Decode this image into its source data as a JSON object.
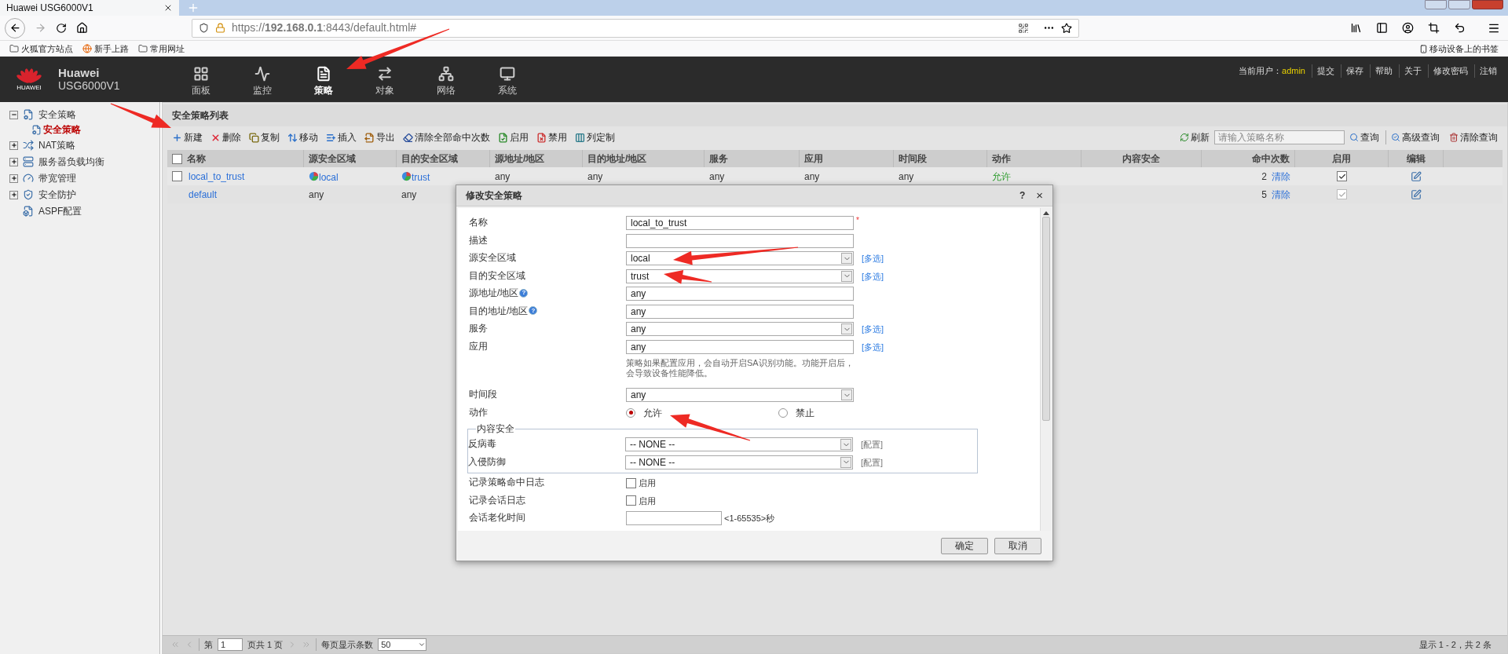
{
  "browser": {
    "tab_title": "Huawei USG6000V1",
    "url": "https://**192.168.0.1**:8443/default.html#",
    "bookmarks": [
      "火狐官方站点",
      "新手上路",
      "常用网址"
    ],
    "mobile_bookmarks": "移动设备上的书签"
  },
  "header": {
    "logo_text": "HUAWEI",
    "brand": "Huawei",
    "model": "USG6000V1",
    "nav": [
      {
        "label": "面板",
        "selected": false
      },
      {
        "label": "监控",
        "selected": false
      },
      {
        "label": "策略",
        "selected": true
      },
      {
        "label": "对象",
        "selected": false
      },
      {
        "label": "网络",
        "selected": false
      },
      {
        "label": "系统",
        "selected": false
      }
    ],
    "user_label": "当前用户：",
    "user": "admin",
    "links": [
      "提交",
      "保存",
      "帮助",
      "关于",
      "修改密码",
      "注销"
    ]
  },
  "sidebar": {
    "items": [
      {
        "label": "安全策略",
        "expanded": true,
        "selected": false,
        "children": [
          {
            "label": "安全策略",
            "selected": true
          }
        ]
      },
      {
        "label": "NAT策略",
        "expanded": false,
        "selected": false
      },
      {
        "label": "服务器负载均衡",
        "expanded": false,
        "selected": false
      },
      {
        "label": "带宽管理",
        "expanded": false,
        "selected": false
      },
      {
        "label": "安全防护",
        "expanded": false,
        "selected": false
      },
      {
        "label": "ASPF配置",
        "selected": false
      }
    ]
  },
  "panel": {
    "title": "安全策略列表",
    "toolbar": [
      "新建",
      "删除",
      "复制",
      "移动",
      "插入",
      "导出",
      "清除全部命中次数",
      "启用",
      "禁用",
      "列定制"
    ],
    "refresh": "刷新",
    "search": {
      "placeholder": "请输入策略名称"
    },
    "query": "查询",
    "advanced_query": "高级查询",
    "clear_query": "清除查询",
    "table": {
      "select_all_checked": false,
      "columns": [
        "名称",
        "源安全区域",
        "目的安全区域",
        "源地址/地区",
        "目的地址/地区",
        "服务",
        "应用",
        "时间段",
        "动作",
        "内容安全",
        "命中次数",
        "启用",
        "编辑"
      ],
      "rows": [
        {
          "checked": false,
          "name": "local_to_trust",
          "src_zone": "local",
          "dst_zone": "trust",
          "src_zone_icon": true,
          "src_addr": "any",
          "dst_addr": "any",
          "service": "any",
          "application": "any",
          "schedule": "any",
          "action": "允许",
          "hits": "2",
          "clear": "清除",
          "enabled": true,
          "enabled_disabled": false
        },
        {
          "name": "default",
          "src_zone": "any",
          "dst_zone": "any",
          "src_zone_icon": false,
          "hits": "5",
          "clear": "清除",
          "enabled": true,
          "enabled_disabled": true
        }
      ]
    }
  },
  "pagination": {
    "page_prefix": "第",
    "page": "1",
    "page_suffix": "页共 1 页",
    "per_page_label": "每页显示条数",
    "per_page": "50",
    "summary": "显示 1 - 2，共 2 条"
  },
  "dialog": {
    "title": "修改安全策略",
    "help": "?",
    "close": "×",
    "fields": [
      {
        "kind": "text",
        "label": "名称",
        "value": "local_to_trust",
        "required": "*"
      },
      {
        "kind": "text",
        "label": "描述"
      },
      {
        "kind": "select",
        "label": "源安全区域",
        "value": "local",
        "link": {
          "label": "[多选]",
          "disabled": false
        }
      },
      {
        "kind": "select",
        "label": "目的安全区域",
        "value": "trust",
        "link": {
          "label": "[多选]",
          "disabled": false
        }
      },
      {
        "kind": "text",
        "label": "源地址/地区",
        "value": "any",
        "help": "?"
      },
      {
        "kind": "text",
        "label": "目的地址/地区",
        "value": "any",
        "help": "?"
      },
      {
        "kind": "select",
        "label": "服务",
        "value": "any",
        "link": {
          "label": "[多选]",
          "disabled": false
        }
      },
      {
        "kind": "text",
        "label": "应用",
        "value": "any",
        "link": {
          "label": "[多选]",
          "disabled": false
        },
        "note": "策略如果配置应用，会自动开启SA识别功能。功能开启后，会导致设备性能降低。"
      },
      {
        "kind": "select",
        "label": "时间段",
        "value": "any"
      },
      {
        "kind": "radio",
        "label": "动作",
        "options": [
          {
            "label": "允许",
            "selected": true
          },
          {
            "label": "禁止",
            "selected": false
          }
        ]
      },
      {
        "kind": "group",
        "legend": "内容安全",
        "children": [
          {
            "kind": "select",
            "label": "反病毒",
            "value": "-- NONE --",
            "link": {
              "label": "[配置]",
              "disabled": true
            }
          },
          {
            "kind": "select",
            "label": "入侵防御",
            "value": "-- NONE --",
            "link": {
              "label": "[配置]",
              "disabled": true
            }
          }
        ]
      },
      {
        "kind": "checkbox",
        "label": "记录策略命中日志",
        "option": "启用",
        "checked": false
      },
      {
        "kind": "checkbox",
        "label": "记录会话日志",
        "option": "启用",
        "checked": false
      },
      {
        "kind": "number",
        "label": "会话老化时间",
        "suffix": "<1-65535>秒"
      }
    ],
    "buttons": [
      "确定",
      "取消"
    ]
  }
}
